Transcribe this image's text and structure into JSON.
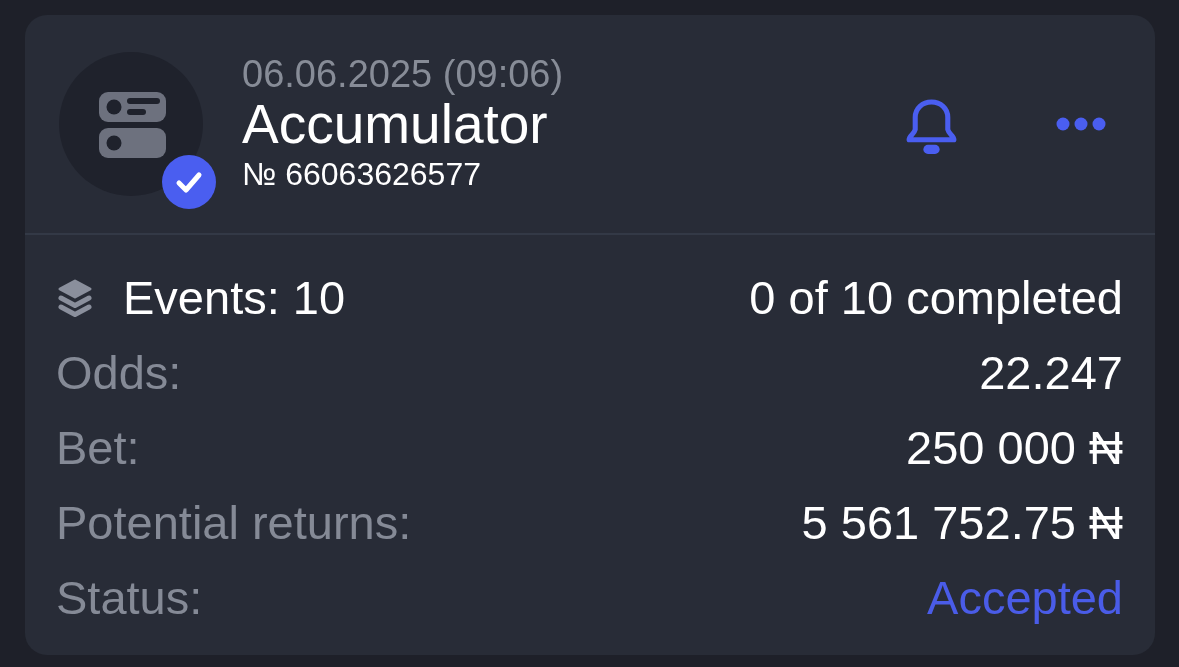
{
  "bet": {
    "date": "06.06.2025 (09:06)",
    "type": "Accumulator",
    "number": "№ 66063626577",
    "verified": true
  },
  "events": {
    "label": "Events: 10",
    "summary": "0 of 10 completed"
  },
  "details": [
    {
      "kind": "plain",
      "label": "Odds:",
      "value": "22.247"
    },
    {
      "kind": "plain",
      "label": "Bet:",
      "value": "250 000 ₦"
    },
    {
      "kind": "plain",
      "label": "Potential returns:",
      "value": "5 561 752.75 ₦"
    },
    {
      "kind": "status",
      "label": "Status:",
      "value": "Accepted"
    }
  ]
}
